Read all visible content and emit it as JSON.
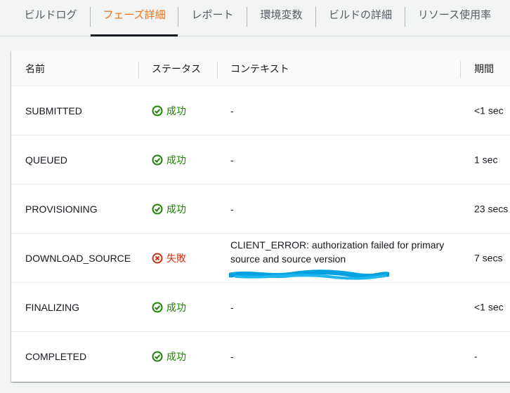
{
  "tabs": [
    {
      "label": "ビルドログ",
      "active": false
    },
    {
      "label": "フェーズ詳細",
      "active": true
    },
    {
      "label": "レポート",
      "active": false
    },
    {
      "label": "環境変数",
      "active": false
    },
    {
      "label": "ビルドの詳細",
      "active": false
    },
    {
      "label": "リソース使用率",
      "active": false
    }
  ],
  "table": {
    "headers": {
      "name": "名前",
      "status": "ステータス",
      "context": "コンテキスト",
      "duration": "期間"
    },
    "rows": [
      {
        "name": "SUBMITTED",
        "status": "成功",
        "status_type": "success",
        "context": "-",
        "duration": "<1 sec"
      },
      {
        "name": "QUEUED",
        "status": "成功",
        "status_type": "success",
        "context": "-",
        "duration": "1 sec"
      },
      {
        "name": "PROVISIONING",
        "status": "成功",
        "status_type": "success",
        "context": "-",
        "duration": "23 secs"
      },
      {
        "name": "DOWNLOAD_SOURCE",
        "status": "失敗",
        "status_type": "error",
        "context": "CLIENT_ERROR: authorization failed for primary source and source version",
        "duration": "7 secs"
      },
      {
        "name": "FINALIZING",
        "status": "成功",
        "status_type": "success",
        "context": "-",
        "duration": "<1 sec"
      },
      {
        "name": "COMPLETED",
        "status": "成功",
        "status_type": "success",
        "context": "-",
        "duration": "-"
      }
    ]
  },
  "icons": {
    "success": "check-circle-icon",
    "error": "x-circle-icon"
  },
  "colors": {
    "active_tab": "#ec7211",
    "success": "#1d8102",
    "error": "#d13212",
    "redaction": "#00a1e0"
  }
}
